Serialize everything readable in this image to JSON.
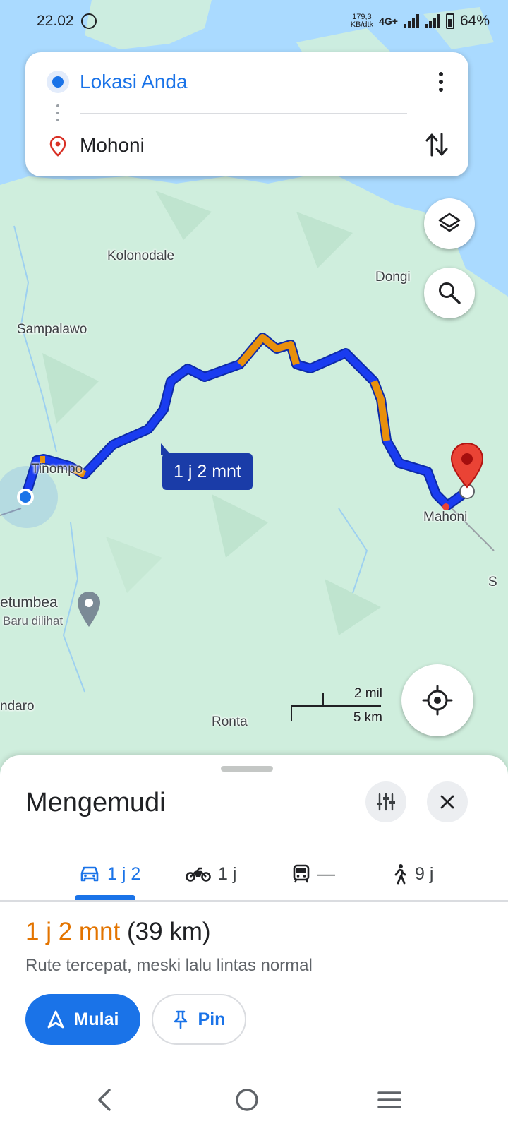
{
  "status_bar": {
    "time": "22.02",
    "app_icon": "whatsapp-icon",
    "data_rate_value": "179,3",
    "data_rate_unit": "KB/dtk",
    "network": "4G+",
    "battery": "64%"
  },
  "directions": {
    "origin": "Lokasi Anda",
    "destination": "Mohoni",
    "icons": [
      "origin-dot-icon",
      "location-pin-icon",
      "more-vert-icon",
      "swap-icon"
    ]
  },
  "map": {
    "labels": {
      "kolonodale": "Kolonodale",
      "dongi": "Dongi",
      "sampalawo": "Sampalawo",
      "tinompo": "Tinompo",
      "mahoni": "Mahoni",
      "poi_name": "etumbea",
      "poi_sub": "Baru dilihat",
      "ndaro": "ndaro",
      "ronta": "Ronta",
      "edge_s": "S"
    },
    "route_chip": "1 j 2 mnt",
    "scale": {
      "imperial": "2 mil",
      "metric": "5 km"
    },
    "colors": {
      "route": "#1a3cf0",
      "traffic": "#e8900c",
      "water": "#aadaff",
      "land": "#cfeedd",
      "pin": "#ea4335"
    }
  },
  "sheet": {
    "title": "Mengemudi",
    "modes": [
      {
        "icon": "car-icon",
        "label": "1 j 2"
      },
      {
        "icon": "motorcycle-icon",
        "label": "1 j"
      },
      {
        "icon": "transit-icon",
        "label": "—"
      },
      {
        "icon": "walk-icon",
        "label": "9 j"
      }
    ],
    "duration": "1 j 2 mnt",
    "distance": "(39 km)",
    "description": "Rute tercepat, meski lalu lintas normal",
    "start_label": "Mulai",
    "pin_label": "Pin"
  }
}
